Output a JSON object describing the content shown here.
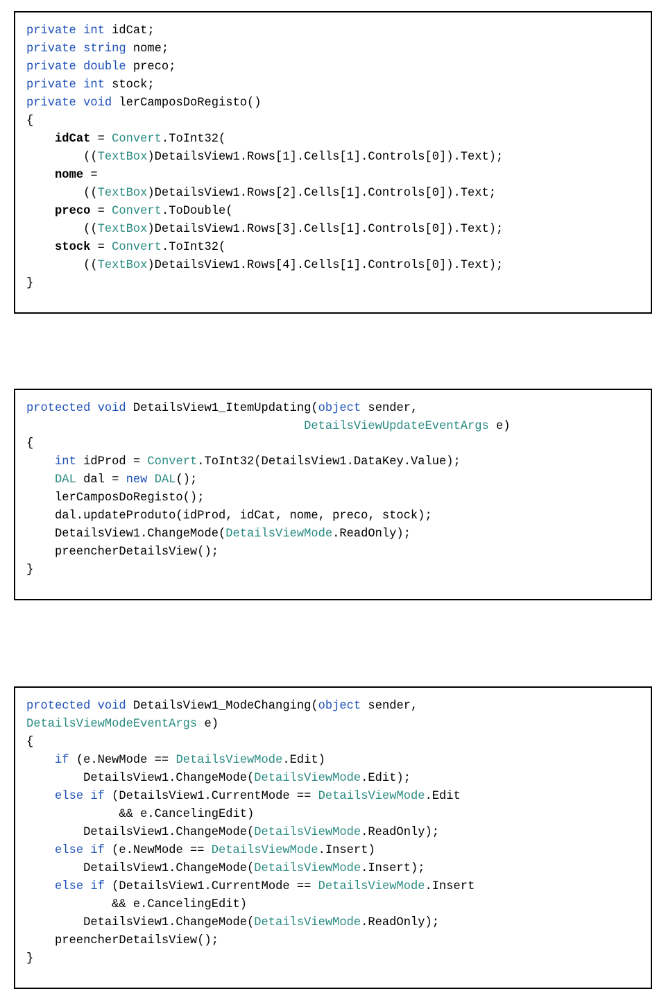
{
  "blocks": [
    {
      "lines": [
        {
          "tokens": [
            {
              "t": "private",
              "c": "kw"
            },
            {
              "t": " "
            },
            {
              "t": "int",
              "c": "kw"
            },
            {
              "t": " idCat;"
            }
          ]
        },
        {
          "tokens": [
            {
              "t": "private",
              "c": "kw"
            },
            {
              "t": " "
            },
            {
              "t": "string",
              "c": "kw"
            },
            {
              "t": " nome;"
            }
          ]
        },
        {
          "tokens": [
            {
              "t": "private",
              "c": "kw"
            },
            {
              "t": " "
            },
            {
              "t": "double",
              "c": "kw"
            },
            {
              "t": " preco;"
            }
          ]
        },
        {
          "tokens": [
            {
              "t": "private",
              "c": "kw"
            },
            {
              "t": " "
            },
            {
              "t": "int",
              "c": "kw"
            },
            {
              "t": " stock;"
            }
          ]
        },
        {
          "tokens": [
            {
              "t": ""
            }
          ]
        },
        {
          "tokens": [
            {
              "t": "private",
              "c": "kw"
            },
            {
              "t": " "
            },
            {
              "t": "void",
              "c": "kw"
            },
            {
              "t": " lerCamposDoRegisto()"
            }
          ]
        },
        {
          "tokens": [
            {
              "t": "{"
            }
          ]
        },
        {
          "tokens": [
            {
              "t": "    "
            },
            {
              "t": "idCat",
              "c": "bold"
            },
            {
              "t": " = "
            },
            {
              "t": "Convert",
              "c": "cls"
            },
            {
              "t": ".ToInt32("
            }
          ]
        },
        {
          "tokens": [
            {
              "t": "        (("
            },
            {
              "t": "TextBox",
              "c": "cls"
            },
            {
              "t": ")DetailsView1.Rows[1].Cells[1].Controls[0]).Text);"
            }
          ]
        },
        {
          "tokens": [
            {
              "t": "    "
            },
            {
              "t": "nome",
              "c": "bold"
            },
            {
              "t": " ="
            }
          ]
        },
        {
          "tokens": [
            {
              "t": "        (("
            },
            {
              "t": "TextBox",
              "c": "cls"
            },
            {
              "t": ")DetailsView1.Rows[2].Cells[1].Controls[0]).Text;"
            }
          ]
        },
        {
          "tokens": [
            {
              "t": "    "
            },
            {
              "t": "preco",
              "c": "bold"
            },
            {
              "t": " = "
            },
            {
              "t": "Convert",
              "c": "cls"
            },
            {
              "t": ".ToDouble("
            }
          ]
        },
        {
          "tokens": [
            {
              "t": "        (("
            },
            {
              "t": "TextBox",
              "c": "cls"
            },
            {
              "t": ")DetailsView1.Rows[3].Cells[1].Controls[0]).Text);"
            }
          ]
        },
        {
          "tokens": [
            {
              "t": "    "
            },
            {
              "t": "stock",
              "c": "bold"
            },
            {
              "t": " = "
            },
            {
              "t": "Convert",
              "c": "cls"
            },
            {
              "t": ".ToInt32("
            }
          ]
        },
        {
          "tokens": [
            {
              "t": "        (("
            },
            {
              "t": "TextBox",
              "c": "cls"
            },
            {
              "t": ")DetailsView1.Rows[4].Cells[1].Controls[0]).Text);"
            }
          ]
        },
        {
          "tokens": [
            {
              "t": "}"
            }
          ]
        }
      ]
    },
    {
      "lines": [
        {
          "tokens": [
            {
              "t": "protected",
              "c": "kw"
            },
            {
              "t": " "
            },
            {
              "t": "void",
              "c": "kw"
            },
            {
              "t": " DetailsView1_ItemUpdating("
            },
            {
              "t": "object",
              "c": "kw"
            },
            {
              "t": " sender,"
            }
          ]
        },
        {
          "tokens": [
            {
              "t": "                                       "
            },
            {
              "t": "DetailsViewUpdateEventArgs",
              "c": "cls"
            },
            {
              "t": " e)"
            }
          ]
        },
        {
          "tokens": [
            {
              "t": "{"
            }
          ]
        },
        {
          "tokens": [
            {
              "t": "    "
            },
            {
              "t": "int",
              "c": "kw"
            },
            {
              "t": " idProd = "
            },
            {
              "t": "Convert",
              "c": "cls"
            },
            {
              "t": ".ToInt32(DetailsView1.DataKey.Value);"
            }
          ]
        },
        {
          "tokens": [
            {
              "t": "    "
            },
            {
              "t": "DAL",
              "c": "cls"
            },
            {
              "t": " dal = "
            },
            {
              "t": "new",
              "c": "kw"
            },
            {
              "t": " "
            },
            {
              "t": "DAL",
              "c": "cls"
            },
            {
              "t": "();"
            }
          ]
        },
        {
          "tokens": [
            {
              "t": "    lerCamposDoRegisto();"
            }
          ]
        },
        {
          "tokens": [
            {
              "t": "    dal.updateProduto(idProd, idCat, nome, preco, stock);"
            }
          ]
        },
        {
          "tokens": [
            {
              "t": "    DetailsView1.ChangeMode("
            },
            {
              "t": "DetailsViewMode",
              "c": "cls"
            },
            {
              "t": ".ReadOnly);"
            }
          ]
        },
        {
          "tokens": [
            {
              "t": "    preencherDetailsView();"
            }
          ]
        },
        {
          "tokens": [
            {
              "t": "}"
            }
          ]
        }
      ]
    },
    {
      "lines": [
        {
          "tokens": [
            {
              "t": "protected",
              "c": "kw"
            },
            {
              "t": " "
            },
            {
              "t": "void",
              "c": "kw"
            },
            {
              "t": " DetailsView1_ModeChanging("
            },
            {
              "t": "object",
              "c": "kw"
            },
            {
              "t": " sender,"
            }
          ]
        },
        {
          "tokens": [
            {
              "t": "DetailsViewModeEventArgs",
              "c": "cls"
            },
            {
              "t": " e)"
            }
          ]
        },
        {
          "tokens": [
            {
              "t": "{"
            }
          ]
        },
        {
          "tokens": [
            {
              "t": "    "
            },
            {
              "t": "if",
              "c": "kw"
            },
            {
              "t": " (e.NewMode == "
            },
            {
              "t": "DetailsViewMode",
              "c": "cls"
            },
            {
              "t": ".Edit)"
            }
          ]
        },
        {
          "tokens": [
            {
              "t": "        DetailsView1.ChangeMode("
            },
            {
              "t": "DetailsViewMode",
              "c": "cls"
            },
            {
              "t": ".Edit);"
            }
          ]
        },
        {
          "tokens": [
            {
              "t": "    "
            },
            {
              "t": "else",
              "c": "kw"
            },
            {
              "t": " "
            },
            {
              "t": "if",
              "c": "kw"
            },
            {
              "t": " (DetailsView1.CurrentMode == "
            },
            {
              "t": "DetailsViewMode",
              "c": "cls"
            },
            {
              "t": ".Edit"
            }
          ]
        },
        {
          "tokens": [
            {
              "t": "             && e.CancelingEdit)"
            }
          ]
        },
        {
          "tokens": [
            {
              "t": "        DetailsView1.ChangeMode("
            },
            {
              "t": "DetailsViewMode",
              "c": "cls"
            },
            {
              "t": ".ReadOnly);"
            }
          ]
        },
        {
          "tokens": [
            {
              "t": "    "
            },
            {
              "t": "else",
              "c": "kw"
            },
            {
              "t": " "
            },
            {
              "t": "if",
              "c": "kw"
            },
            {
              "t": " (e.NewMode == "
            },
            {
              "t": "DetailsViewMode",
              "c": "cls"
            },
            {
              "t": ".Insert)"
            }
          ]
        },
        {
          "tokens": [
            {
              "t": "        DetailsView1.ChangeMode("
            },
            {
              "t": "DetailsViewMode",
              "c": "cls"
            },
            {
              "t": ".Insert);"
            }
          ]
        },
        {
          "tokens": [
            {
              "t": "    "
            },
            {
              "t": "else",
              "c": "kw"
            },
            {
              "t": " "
            },
            {
              "t": "if",
              "c": "kw"
            },
            {
              "t": " (DetailsView1.CurrentMode == "
            },
            {
              "t": "DetailsViewMode",
              "c": "cls"
            },
            {
              "t": ".Insert"
            }
          ]
        },
        {
          "tokens": [
            {
              "t": "            && e.CancelingEdit)"
            }
          ]
        },
        {
          "tokens": [
            {
              "t": "        DetailsView1.ChangeMode("
            },
            {
              "t": "DetailsViewMode",
              "c": "cls"
            },
            {
              "t": ".ReadOnly);"
            }
          ]
        },
        {
          "tokens": [
            {
              "t": "    preencherDetailsView();"
            }
          ]
        },
        {
          "tokens": [
            {
              "t": "}"
            }
          ]
        }
      ]
    }
  ]
}
